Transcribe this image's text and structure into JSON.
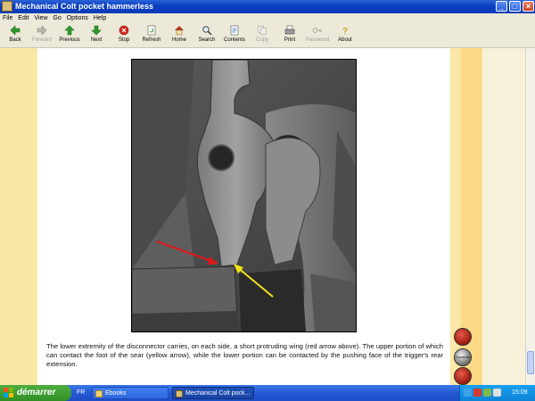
{
  "window": {
    "title": "Mechanical Colt pocket hammerless",
    "minimize": "_",
    "maximize": "□",
    "close": "×"
  },
  "menu": [
    "File",
    "Edit",
    "View",
    "Go",
    "Options",
    "Help"
  ],
  "toolbar": [
    {
      "label": "Back",
      "icon": "back-arrow-icon",
      "enabled": true
    },
    {
      "label": "Forward",
      "icon": "forward-arrow-icon",
      "enabled": false
    },
    {
      "label": "Previous",
      "icon": "up-arrow-icon",
      "enabled": true
    },
    {
      "label": "Next",
      "icon": "down-arrow-icon",
      "enabled": true
    },
    {
      "label": "Stop",
      "icon": "stop-icon",
      "enabled": true
    },
    {
      "label": "Refresh",
      "icon": "refresh-icon",
      "enabled": true
    },
    {
      "label": "Home",
      "icon": "home-icon",
      "enabled": true
    },
    {
      "label": "Search",
      "icon": "search-icon",
      "enabled": true
    },
    {
      "label": "Contents",
      "icon": "contents-icon",
      "enabled": true
    },
    {
      "label": "Copy",
      "icon": "copy-icon",
      "enabled": false
    },
    {
      "label": "Print",
      "icon": "print-icon",
      "enabled": true
    },
    {
      "label": "Password",
      "icon": "key-icon",
      "enabled": false
    },
    {
      "label": "About",
      "icon": "help-icon",
      "enabled": true
    }
  ],
  "content": {
    "caption": "The lower extremity of the disconnector carries, on each side, a short protruding wing (red arrow above). The upper portion of which can contact the foot of the sear (yellow arrow), while the lower portion can be contacted by the pushing face of the trigger's rear extension.",
    "nav_middle_label": "Contents",
    "arrow_colors": {
      "red": "#e01818",
      "yellow": "#f2e21a"
    },
    "band_colors": {
      "left": "#fbe7a6",
      "right": "#fbd985"
    }
  },
  "taskbar": {
    "start": "démarrer",
    "lang": "FR",
    "tasks": [
      "Ebooks",
      "Mechanical Colt pock..."
    ],
    "clock": "15:09"
  }
}
